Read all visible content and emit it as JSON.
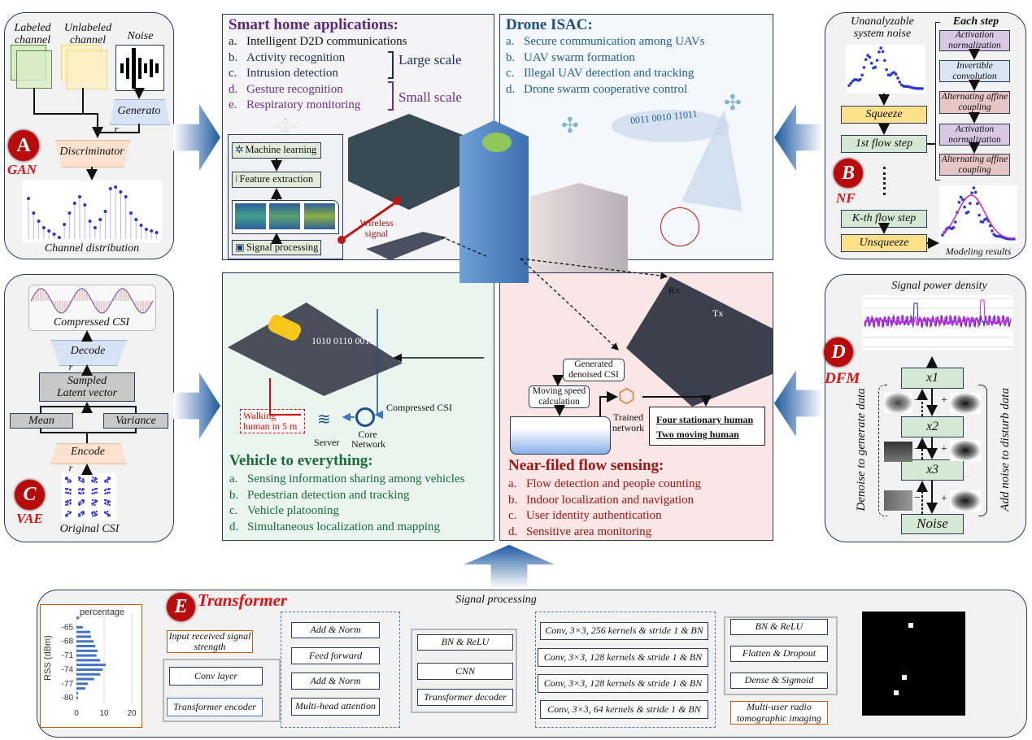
{
  "panel_a": {
    "labeled": "Labeled channel",
    "unlabeled": "Unlabeled channel",
    "noise": "Noise",
    "generator": "Generato",
    "generator_r": "r",
    "discriminator": "Discriminator",
    "badge": "A",
    "tag": "GAN",
    "caption": "Channel distribution"
  },
  "panel_b": {
    "noise_title": "Unanalyzable system noise",
    "squeeze": "Squeeze",
    "first_step": "1st flow step",
    "kth_step": "K-th flow step",
    "unsqueeze": "Unsqueeze",
    "each_step": "Each step",
    "steps": [
      "Activation normalization",
      "Invertible convolution",
      "Alternating affine coupling",
      "Activation normalization",
      "Alternating affine coupling"
    ],
    "badge": "B",
    "tag": "NF",
    "caption": "Modeling results"
  },
  "panel_c": {
    "compressed": "Compressed CSI",
    "decode": "Decode",
    "decode_r": "r",
    "latent": "Sampled Latent vector",
    "mean": "Mean",
    "variance": "Variance",
    "encode": "Encode",
    "encode_r": "r",
    "original": "Original CSI",
    "badge": "C",
    "tag": "VAE"
  },
  "panel_d": {
    "title": "Signal power density",
    "steps": [
      "x1",
      "x2",
      "x3",
      "Noise"
    ],
    "left_label": "Denoise to generate data",
    "right_label": "Add noise to disturb data",
    "minus": "−",
    "plus": "+",
    "badge": "D",
    "tag": "DFM"
  },
  "smart_home": {
    "title": "Smart home applications:",
    "items": [
      {
        "k": "a.",
        "t": "Intelligent D2D communications"
      },
      {
        "k": "b.",
        "t": "Activity recognition"
      },
      {
        "k": "c.",
        "t": "Intrusion detection"
      },
      {
        "k": "d.",
        "t": "Gesture recognition"
      },
      {
        "k": "e.",
        "t": "Respiratory monitoring"
      }
    ],
    "large": "Large scale",
    "small": "Small scale",
    "pipeline": [
      "Machine learning",
      "Feature extraction",
      "Signal processing"
    ],
    "wireless": "Wireless signal",
    "colors": {
      "title": "#5b2a7e",
      "small": "#6b2f8a",
      "large": "#1f2f55"
    }
  },
  "drone": {
    "title": "Drone ISAC:",
    "items": [
      {
        "k": "a.",
        "t": "Secure communication among UAVs"
      },
      {
        "k": "b.",
        "t": "UAV swarm formation"
      },
      {
        "k": "c.",
        "t": "Illegal UAV detection and tracking"
      },
      {
        "k": "d.",
        "t": "Drone swarm cooperative control"
      }
    ],
    "bits": "0011 0010 11011",
    "color": "#1f5f9a"
  },
  "v2x": {
    "title": "Vehicle to everything:",
    "items": [
      {
        "k": "a.",
        "t": "Sensing information sharing among vehicles"
      },
      {
        "k": "b.",
        "t": "Pedestrian detection and tracking"
      },
      {
        "k": "c.",
        "t": "Vehicle platooning"
      },
      {
        "k": "d.",
        "t": "Simultaneous localization and mapping"
      }
    ],
    "bits": "1010 0110 0011",
    "vbits": "0011 0010 1101",
    "compressed": "Compressed CSI",
    "server": "Server",
    "core": "Core Network",
    "walking": "Walking human in 5 m",
    "color": "#1a6b3a"
  },
  "near_field": {
    "title": "Near-filed flow sensing:",
    "items": [
      {
        "k": "a.",
        "t": "Flow detection and people counting"
      },
      {
        "k": "b.",
        "t": "Indoor localization and navigation"
      },
      {
        "k": "c.",
        "t": "User identity authentication"
      },
      {
        "k": "d.",
        "t": "Sensitive area monitoring"
      }
    ],
    "rx": "Rx",
    "tx": "Tx",
    "generated": "Generated denoised CSI",
    "speed": "Moving speed calculation",
    "trained": "Trained network",
    "result1": "Four stationary human",
    "result2": "Two moving human",
    "color": "#a01515"
  },
  "panel_e": {
    "badge": "E",
    "tag": "Transformer",
    "signal_processing": "Signal processing",
    "input": "Input received signal strength",
    "conv_layer": "Conv layer",
    "encoder": "Transformer encoder",
    "encoder_blocks": [
      "Add & Norm",
      "Feed forward",
      "Add & Norm",
      "Multi-head attention"
    ],
    "decoder_blocks": [
      "BN & ReLU",
      "CNN",
      "Transformer decoder"
    ],
    "conv_blocks": [
      "Conv, 3×3, 256 kernels & stride 1 & BN",
      "Conv, 3×3, 128 kernels & stride 1 & BN",
      "Conv, 3×3, 128 kernels & stride 1 & BN",
      "Conv, 3×3, 64 kernels & stride 1 & BN"
    ],
    "head_blocks": [
      "BN & ReLU",
      "Flatten & Dropout",
      "Dense & Sigmoid"
    ],
    "output": "Multi-user radio tomographic imaging"
  },
  "chart_data": {
    "type": "bar",
    "orientation": "horizontal",
    "title": "percentage",
    "ylabel": "RSS (dBm)",
    "xlabel": "",
    "categories": [
      -63,
      -65,
      -66,
      -67,
      -68,
      -69,
      -70,
      -71,
      -72,
      -73,
      -74,
      -75,
      -76,
      -77,
      -78,
      -79,
      -80
    ],
    "values": [
      1,
      2.3,
      5,
      5.3,
      6.2,
      6.8,
      7.7,
      7.3,
      8.6,
      10.6,
      9.5,
      8.6,
      6.4,
      4.1,
      3.2,
      0.6,
      0.6
    ],
    "yticks": [
      "-65",
      "-68",
      "-71",
      "-74",
      "-77",
      "-80"
    ],
    "xticks": [
      "0",
      "10",
      "20"
    ],
    "xlim": [
      0,
      20
    ],
    "ylim": [
      -62,
      -81
    ],
    "grid": true,
    "bar_color": "#4472c4"
  }
}
